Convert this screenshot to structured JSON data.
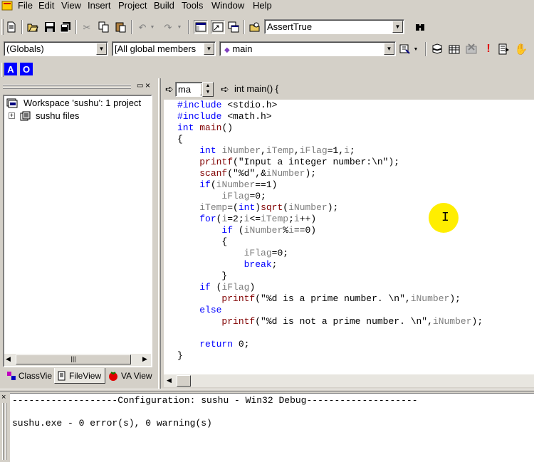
{
  "menu": [
    "File",
    "Edit",
    "View",
    "Insert",
    "Project",
    "Build",
    "Tools",
    "Window",
    "Help"
  ],
  "toolbar": {
    "find_combo_value": "AssertTrue"
  },
  "wizardbar": {
    "class_combo": "(Globals)",
    "filter_combo": "[All global members",
    "member_combo": "main"
  },
  "va_toolbar": {
    "btn_a": "A",
    "btn_o": "O"
  },
  "editor_nav": {
    "left_combo": "ma",
    "right_combo": "int main() {"
  },
  "workspace": {
    "root_label": "Workspace 'sushu': 1 project",
    "files_label": "sushu files"
  },
  "tabs": {
    "classview": "ClassVie",
    "fileview": "FileView",
    "vaview": "VA View"
  },
  "code": [
    {
      "t": "#include <stdio.h>",
      "c": "kw"
    },
    {
      "t": "#include <math.h>",
      "c": "kw"
    },
    {
      "t": "int main()",
      "c": "main"
    },
    {
      "t": "{",
      "c": "plain"
    },
    {
      "t": "    int iNumber,iTemp,iFlag=1,i;",
      "c": "decl"
    },
    {
      "t": "    printf(\"Input a integer number:\\n\");",
      "c": "call"
    },
    {
      "t": "    scanf(\"%d\",&iNumber);",
      "c": "call"
    },
    {
      "t": "    if(iNumber==1)",
      "c": "ctrl"
    },
    {
      "t": "        iFlag=0;",
      "c": "var"
    },
    {
      "t": "    iTemp=(int)sqrt(iNumber);",
      "c": "mixed"
    },
    {
      "t": "    for(i=2;i<=iTemp;i++)",
      "c": "ctrl"
    },
    {
      "t": "        if (iNumber%i==0)",
      "c": "ctrl"
    },
    {
      "t": "        {",
      "c": "plain"
    },
    {
      "t": "            iFlag=0;",
      "c": "var"
    },
    {
      "t": "            break;",
      "c": "kw"
    },
    {
      "t": "        }",
      "c": "plain"
    },
    {
      "t": "    if (iFlag)",
      "c": "ctrl"
    },
    {
      "t": "        printf(\"%d is a prime number. \\n\",iNumber);",
      "c": "call"
    },
    {
      "t": "    else",
      "c": "kw"
    },
    {
      "t": "        printf(\"%d is not a prime number. \\n\",iNumber);",
      "c": "call"
    },
    {
      "t": "",
      "c": "plain"
    },
    {
      "t": "    return 0;",
      "c": "kw"
    },
    {
      "t": "}",
      "c": "plain"
    }
  ],
  "output": {
    "line1": "-------------------Configuration: sushu - Win32 Debug--------------------",
    "line2": "sushu.exe - 0 error(s), 0 warning(s)"
  },
  "colors": {
    "keyword": "#0000ff",
    "function": "#800000",
    "variable": "#7d7d7d",
    "highlight": "#ffee00",
    "chrome": "#d4d0c8"
  }
}
